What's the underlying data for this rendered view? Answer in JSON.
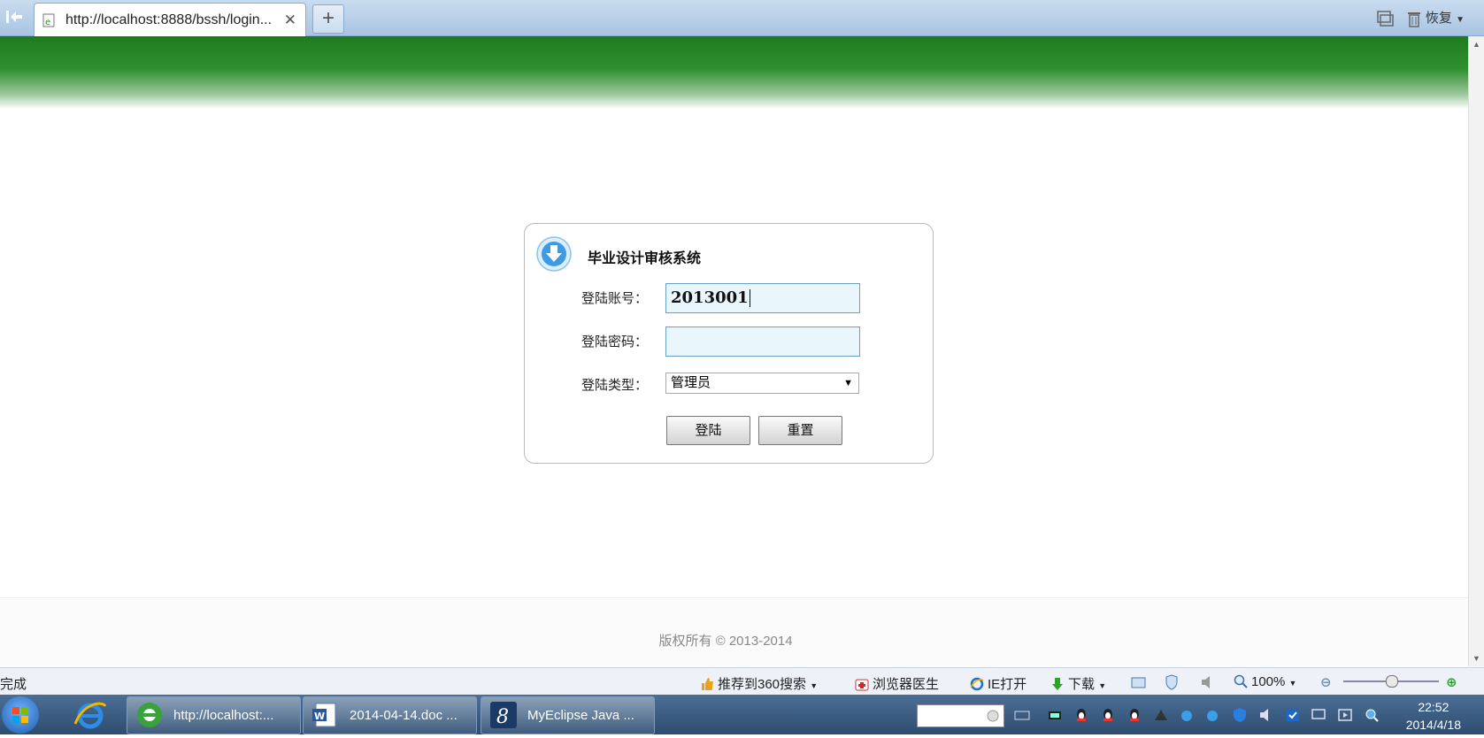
{
  "browser": {
    "tab_title": "http://localhost:8888/bssh/login...",
    "close_glyph": "✕",
    "new_tab_glyph": "+",
    "restore_label": "恢复"
  },
  "login": {
    "system_title": "毕业设计审核系统",
    "account_label": "登陆账号：",
    "account_value": "2013001",
    "password_label": "登陆密码：",
    "password_value": "",
    "type_label": "登陆类型：",
    "type_selected": "管理员",
    "login_button": "登陆",
    "reset_button": "重置"
  },
  "footer": {
    "copyright": "版权所有 © 2013-2014"
  },
  "statusbar": {
    "status": "完成",
    "recommend": "推荐到360搜索",
    "doctor": "浏览器医生",
    "ie_open": "IE打开",
    "download": "下载",
    "zoom": "100%",
    "zoom_level": 0.5
  },
  "taskbar": {
    "tasks": [
      {
        "label": "http://localhost:..."
      },
      {
        "label": "2014-04-14.doc ..."
      },
      {
        "label": "MyEclipse Java ..."
      }
    ],
    "clock_time": "22:52",
    "clock_date": "2014/4/18"
  },
  "colors": {
    "banner_green": "#1e7a1e",
    "input_bg": "#e9f6fb",
    "taskbar": "#2d4c70"
  }
}
